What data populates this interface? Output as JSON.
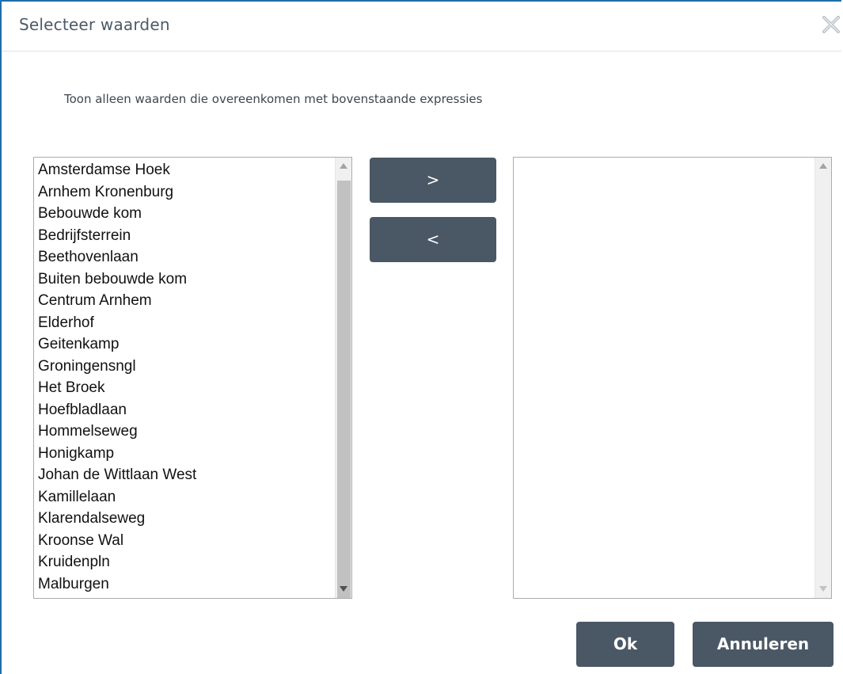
{
  "dialog": {
    "title": "Selecteer waarden",
    "close_icon": "close-icon",
    "instruction": "Toon alleen waarden die overeenkomen met bovenstaande expressies"
  },
  "available_list": {
    "items": [
      "Amsterdamse Hoek",
      "Arnhem Kronenburg",
      "Bebouwde kom",
      "Bedrijfsterrein",
      "Beethovenlaan",
      "Buiten bebouwde kom",
      "Centrum Arnhem",
      "Elderhof",
      "Geitenkamp",
      "Groningensngl",
      "Het Broek",
      "Hoefbladlaan",
      "Hommelseweg",
      "Honigkamp",
      "Johan de Wittlaan West",
      "Kamillelaan",
      "Klarendalseweg",
      "Kroonse Wal",
      "Kruidenpln",
      "Malburgen"
    ]
  },
  "selected_list": {
    "items": []
  },
  "buttons": {
    "add_label": ">",
    "remove_label": "<",
    "ok_label": "Ok",
    "cancel_label": "Annuleren"
  },
  "colors": {
    "button_bg": "#4a5764",
    "dialog_border": "#1e6fa8",
    "title_text": "#4d5a66"
  }
}
